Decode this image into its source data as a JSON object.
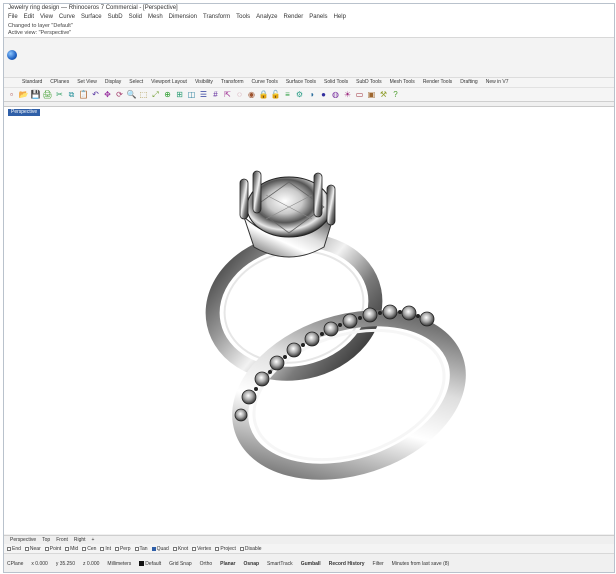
{
  "app": {
    "title": "Jewelry ring design — Rhinoceros 7 Commercial - [Perspective]"
  },
  "menu": {
    "items": [
      "File",
      "Edit",
      "View",
      "Curve",
      "Surface",
      "SubD",
      "Solid",
      "Mesh",
      "Dimension",
      "Transform",
      "Tools",
      "Analyze",
      "Render",
      "Panels",
      "Help"
    ]
  },
  "command_history": {
    "line1": "Changed to layer \"Default\"",
    "line2": "Active view: \"Perspective\""
  },
  "command_prompt": {
    "icon": "rhino-command-icon"
  },
  "toolbar_tabs": [
    "Standard",
    "CPlanes",
    "Set View",
    "Display",
    "Select",
    "Viewport Layout",
    "Visibility",
    "Transform",
    "Curve Tools",
    "Surface Tools",
    "Solid Tools",
    "SubD Tools",
    "Mesh Tools",
    "Render Tools",
    "Drafting",
    "New in V7"
  ],
  "toolbar_icons": [
    "new-file-icon",
    "open-icon",
    "save-icon",
    "print-icon",
    "cut-icon",
    "copy-icon",
    "paste-icon",
    "undo-icon",
    "pan-icon",
    "rotate-view-icon",
    "zoom-icon",
    "zoom-window-icon",
    "zoom-extents-icon",
    "zoom-selected-icon",
    "4-views-icon",
    "cplane-icon",
    "named-views-icon",
    "grid-icon",
    "select-icon",
    "hide-icon",
    "show-icon",
    "lock-icon",
    "unlock-icon",
    "layer-icon",
    "properties-icon",
    "render-icon",
    "material-icon",
    "environment-icon",
    "sun-icon",
    "ground-plane-icon",
    "snapshot-icon",
    "options-icon",
    "help-icon"
  ],
  "viewport": {
    "name": "Perspective",
    "model": "engagement-ring-and-wedding-band"
  },
  "bottom_tabs": [
    "Perspective",
    "Top",
    "Front",
    "Right",
    "+"
  ],
  "osnaps": [
    {
      "label": "End",
      "on": false
    },
    {
      "label": "Near",
      "on": false
    },
    {
      "label": "Point",
      "on": false
    },
    {
      "label": "Mid",
      "on": false
    },
    {
      "label": "Cen",
      "on": false
    },
    {
      "label": "Int",
      "on": false
    },
    {
      "label": "Perp",
      "on": false
    },
    {
      "label": "Tan",
      "on": false
    },
    {
      "label": "Quad",
      "on": true
    },
    {
      "label": "Knot",
      "on": false
    },
    {
      "label": "Vertex",
      "on": false
    },
    {
      "label": "Project",
      "on": false
    },
    {
      "label": "Disable",
      "on": false
    }
  ],
  "status": {
    "cplane": "CPlane",
    "x": "x 0.000",
    "y": "y 35.250",
    "z": "z 0.000",
    "units": "Millimeters",
    "layer": "Default",
    "grid_snap": "Grid Snap",
    "ortho": "Ortho",
    "planar": "Planar",
    "osnap": "Osnap",
    "smarttrack": "SmartTrack",
    "gumball": "Gumball",
    "record_history": "Record History",
    "filter": "Filter",
    "filter_text": "Minutes from last save (8)"
  }
}
